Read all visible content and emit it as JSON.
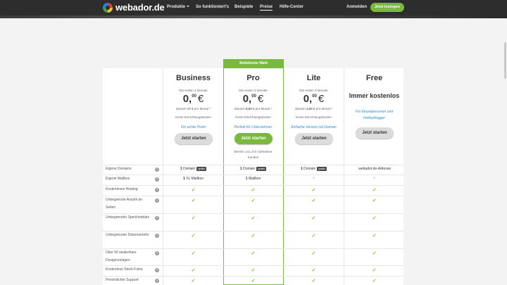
{
  "nav": {
    "logo": "webador.de",
    "links": [
      "Produkte",
      "So funktioniert's",
      "Beispiele",
      "Preise",
      "Hilfe-Center"
    ],
    "login": "Anmelden",
    "cta": "Jetzt loslegen"
  },
  "popular_label": "Beliebteste Wahl",
  "plans": [
    {
      "name": "Business",
      "intro": "Die ersten 3 Monate",
      "price_main": "0,",
      "price_cents": "00",
      "currency": "€",
      "after_pre": "danach",
      "after_amount": "17 €",
      "after_post": "pro Monat *",
      "setup": "Keine Einrichtungskosten",
      "tagline": "Für echte Profis",
      "button": "Jetzt starten"
    },
    {
      "name": "Pro",
      "intro": "Die ersten 3 Monate",
      "price_main": "0,",
      "price_cents": "00",
      "currency": "€",
      "after_pre": "danach",
      "after_amount": "8,50 €",
      "after_post": "pro Monat *",
      "setup": "Keine Einrichtungskosten",
      "tagline": "Perfekt für Unternehmer",
      "button": "Jetzt starten",
      "users": "Bereits 141.274 zufriedene Kunden"
    },
    {
      "name": "Lite",
      "intro": "Die ersten 3 Monate",
      "price_main": "0,",
      "price_cents": "00",
      "currency": "€",
      "after_pre": "danach",
      "after_amount": "4,50 €",
      "after_post": "pro Monat *",
      "setup": "Keine Einrichtungskosten",
      "tagline": "Einfache Version mit Domain",
      "button": "Jetzt starten"
    },
    {
      "name": "Free",
      "free_text": "Immer kostenlos",
      "tagline": "Für Einzelpersonen und Hobbyblogger",
      "button": "Jetzt starten"
    }
  ],
  "badge_label": "gratis",
  "help_glyph": "?",
  "features": [
    {
      "label": "Eigene Domains",
      "cells": [
        {
          "num": "1",
          "text": "Domain",
          "badge": true
        },
        {
          "num": "1",
          "text": "Domain",
          "badge": true
        },
        {
          "num": "1",
          "text": "Domain",
          "badge": true
        },
        {
          "text": ".webador.de-Adresse"
        }
      ]
    },
    {
      "label": "Eigene Mailbox",
      "cells": [
        {
          "num": "1",
          "text": "XL Mailbox"
        },
        {
          "num": "1",
          "text": "Mailbox"
        },
        {
          "mark": "cross"
        },
        {
          "mark": "cross"
        }
      ]
    },
    {
      "label": "Kostenloses Hosting",
      "cells": [
        {
          "mark": "check"
        },
        {
          "mark": "check"
        },
        {
          "mark": "check"
        },
        {
          "mark": "check"
        }
      ]
    },
    {
      "label": "Unbegrenzte Anzahl an Seiten",
      "cells": [
        {
          "mark": "check"
        },
        {
          "mark": "check"
        },
        {
          "mark": "check"
        },
        {
          "mark": "check"
        }
      ]
    },
    {
      "label": "Unbegrenzter Speicherplatz",
      "cells": [
        {
          "mark": "check"
        },
        {
          "mark": "check"
        },
        {
          "mark": "check"
        },
        {
          "mark": "check"
        }
      ]
    },
    {
      "label": "Unbegrenzter Datenverkehr",
      "cells": [
        {
          "mark": "check"
        },
        {
          "mark": "check"
        },
        {
          "mark": "check"
        },
        {
          "mark": "check"
        }
      ]
    },
    {
      "label": "Über 50 skalierbare Designvorlagen",
      "cells": [
        {
          "mark": "check"
        },
        {
          "mark": "check"
        },
        {
          "mark": "check"
        },
        {
          "mark": "check"
        }
      ]
    },
    {
      "label": "Kostenlose Stock-Fotos",
      "cells": [
        {
          "mark": "check"
        },
        {
          "mark": "check"
        },
        {
          "mark": "check"
        },
        {
          "mark": "check"
        }
      ]
    },
    {
      "label": "Persönlicher Support",
      "cells": [
        {
          "mark": "check"
        },
        {
          "mark": "check"
        },
        {
          "mark": "check"
        },
        {
          "mark": "check"
        }
      ]
    }
  ],
  "marks": {
    "check": "✓",
    "cross": "×"
  },
  "colors": {
    "accent": "#79b93e",
    "nav_bg": "#2d2d2d",
    "link_blue": "#2f8fd0"
  }
}
